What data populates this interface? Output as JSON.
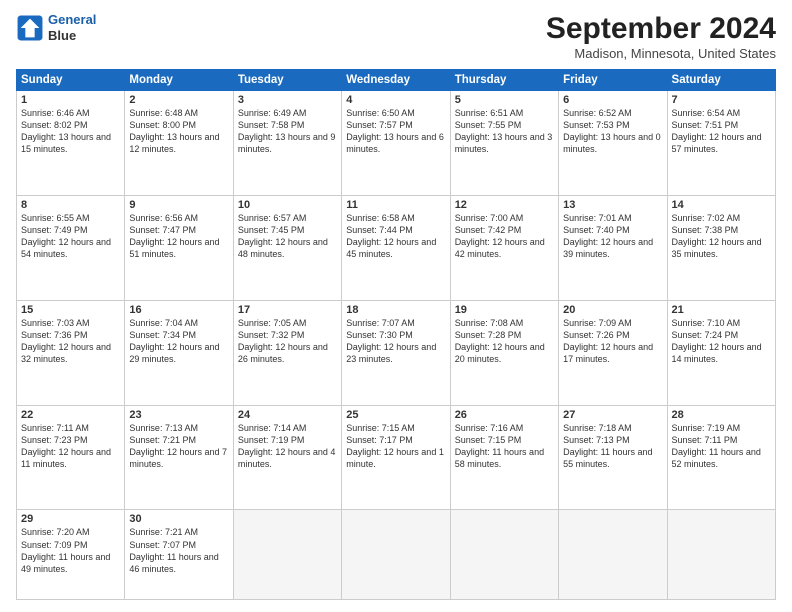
{
  "header": {
    "logo_line1": "General",
    "logo_line2": "Blue",
    "month_title": "September 2024",
    "location": "Madison, Minnesota, United States"
  },
  "weekdays": [
    "Sunday",
    "Monday",
    "Tuesday",
    "Wednesday",
    "Thursday",
    "Friday",
    "Saturday"
  ],
  "weeks": [
    [
      {
        "day": "1",
        "sunrise": "Sunrise: 6:46 AM",
        "sunset": "Sunset: 8:02 PM",
        "daylight": "Daylight: 13 hours and 15 minutes."
      },
      {
        "day": "2",
        "sunrise": "Sunrise: 6:48 AM",
        "sunset": "Sunset: 8:00 PM",
        "daylight": "Daylight: 13 hours and 12 minutes."
      },
      {
        "day": "3",
        "sunrise": "Sunrise: 6:49 AM",
        "sunset": "Sunset: 7:58 PM",
        "daylight": "Daylight: 13 hours and 9 minutes."
      },
      {
        "day": "4",
        "sunrise": "Sunrise: 6:50 AM",
        "sunset": "Sunset: 7:57 PM",
        "daylight": "Daylight: 13 hours and 6 minutes."
      },
      {
        "day": "5",
        "sunrise": "Sunrise: 6:51 AM",
        "sunset": "Sunset: 7:55 PM",
        "daylight": "Daylight: 13 hours and 3 minutes."
      },
      {
        "day": "6",
        "sunrise": "Sunrise: 6:52 AM",
        "sunset": "Sunset: 7:53 PM",
        "daylight": "Daylight: 13 hours and 0 minutes."
      },
      {
        "day": "7",
        "sunrise": "Sunrise: 6:54 AM",
        "sunset": "Sunset: 7:51 PM",
        "daylight": "Daylight: 12 hours and 57 minutes."
      }
    ],
    [
      {
        "day": "8",
        "sunrise": "Sunrise: 6:55 AM",
        "sunset": "Sunset: 7:49 PM",
        "daylight": "Daylight: 12 hours and 54 minutes."
      },
      {
        "day": "9",
        "sunrise": "Sunrise: 6:56 AM",
        "sunset": "Sunset: 7:47 PM",
        "daylight": "Daylight: 12 hours and 51 minutes."
      },
      {
        "day": "10",
        "sunrise": "Sunrise: 6:57 AM",
        "sunset": "Sunset: 7:45 PM",
        "daylight": "Daylight: 12 hours and 48 minutes."
      },
      {
        "day": "11",
        "sunrise": "Sunrise: 6:58 AM",
        "sunset": "Sunset: 7:44 PM",
        "daylight": "Daylight: 12 hours and 45 minutes."
      },
      {
        "day": "12",
        "sunrise": "Sunrise: 7:00 AM",
        "sunset": "Sunset: 7:42 PM",
        "daylight": "Daylight: 12 hours and 42 minutes."
      },
      {
        "day": "13",
        "sunrise": "Sunrise: 7:01 AM",
        "sunset": "Sunset: 7:40 PM",
        "daylight": "Daylight: 12 hours and 39 minutes."
      },
      {
        "day": "14",
        "sunrise": "Sunrise: 7:02 AM",
        "sunset": "Sunset: 7:38 PM",
        "daylight": "Daylight: 12 hours and 35 minutes."
      }
    ],
    [
      {
        "day": "15",
        "sunrise": "Sunrise: 7:03 AM",
        "sunset": "Sunset: 7:36 PM",
        "daylight": "Daylight: 12 hours and 32 minutes."
      },
      {
        "day": "16",
        "sunrise": "Sunrise: 7:04 AM",
        "sunset": "Sunset: 7:34 PM",
        "daylight": "Daylight: 12 hours and 29 minutes."
      },
      {
        "day": "17",
        "sunrise": "Sunrise: 7:05 AM",
        "sunset": "Sunset: 7:32 PM",
        "daylight": "Daylight: 12 hours and 26 minutes."
      },
      {
        "day": "18",
        "sunrise": "Sunrise: 7:07 AM",
        "sunset": "Sunset: 7:30 PM",
        "daylight": "Daylight: 12 hours and 23 minutes."
      },
      {
        "day": "19",
        "sunrise": "Sunrise: 7:08 AM",
        "sunset": "Sunset: 7:28 PM",
        "daylight": "Daylight: 12 hours and 20 minutes."
      },
      {
        "day": "20",
        "sunrise": "Sunrise: 7:09 AM",
        "sunset": "Sunset: 7:26 PM",
        "daylight": "Daylight: 12 hours and 17 minutes."
      },
      {
        "day": "21",
        "sunrise": "Sunrise: 7:10 AM",
        "sunset": "Sunset: 7:24 PM",
        "daylight": "Daylight: 12 hours and 14 minutes."
      }
    ],
    [
      {
        "day": "22",
        "sunrise": "Sunrise: 7:11 AM",
        "sunset": "Sunset: 7:23 PM",
        "daylight": "Daylight: 12 hours and 11 minutes."
      },
      {
        "day": "23",
        "sunrise": "Sunrise: 7:13 AM",
        "sunset": "Sunset: 7:21 PM",
        "daylight": "Daylight: 12 hours and 7 minutes."
      },
      {
        "day": "24",
        "sunrise": "Sunrise: 7:14 AM",
        "sunset": "Sunset: 7:19 PM",
        "daylight": "Daylight: 12 hours and 4 minutes."
      },
      {
        "day": "25",
        "sunrise": "Sunrise: 7:15 AM",
        "sunset": "Sunset: 7:17 PM",
        "daylight": "Daylight: 12 hours and 1 minute."
      },
      {
        "day": "26",
        "sunrise": "Sunrise: 7:16 AM",
        "sunset": "Sunset: 7:15 PM",
        "daylight": "Daylight: 11 hours and 58 minutes."
      },
      {
        "day": "27",
        "sunrise": "Sunrise: 7:18 AM",
        "sunset": "Sunset: 7:13 PM",
        "daylight": "Daylight: 11 hours and 55 minutes."
      },
      {
        "day": "28",
        "sunrise": "Sunrise: 7:19 AM",
        "sunset": "Sunset: 7:11 PM",
        "daylight": "Daylight: 11 hours and 52 minutes."
      }
    ],
    [
      {
        "day": "29",
        "sunrise": "Sunrise: 7:20 AM",
        "sunset": "Sunset: 7:09 PM",
        "daylight": "Daylight: 11 hours and 49 minutes."
      },
      {
        "day": "30",
        "sunrise": "Sunrise: 7:21 AM",
        "sunset": "Sunset: 7:07 PM",
        "daylight": "Daylight: 11 hours and 46 minutes."
      },
      {
        "day": "",
        "sunrise": "",
        "sunset": "",
        "daylight": ""
      },
      {
        "day": "",
        "sunrise": "",
        "sunset": "",
        "daylight": ""
      },
      {
        "day": "",
        "sunrise": "",
        "sunset": "",
        "daylight": ""
      },
      {
        "day": "",
        "sunrise": "",
        "sunset": "",
        "daylight": ""
      },
      {
        "day": "",
        "sunrise": "",
        "sunset": "",
        "daylight": ""
      }
    ]
  ]
}
